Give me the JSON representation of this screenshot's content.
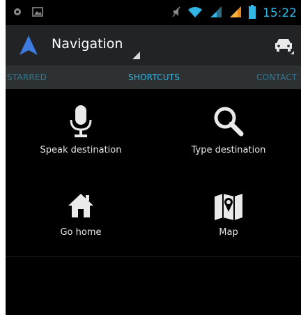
{
  "status_bar": {
    "time": "15:22",
    "icons": [
      "notification-dot-icon",
      "image-icon",
      "mute-icon",
      "wifi-icon",
      "signal-icon",
      "signal-icon",
      "battery-icon"
    ]
  },
  "action_bar": {
    "title": "Navigation",
    "logo_icon": "navigation-arrow-icon",
    "action_icon": "car-icon"
  },
  "tabs": [
    {
      "label": "STARRED"
    },
    {
      "label": "SHORTCUTS",
      "selected": true
    },
    {
      "label": "CONTACT"
    }
  ],
  "shortcuts": [
    {
      "label": "Speak destination",
      "icon": "microphone-icon"
    },
    {
      "label": "Type destination",
      "icon": "search-icon"
    },
    {
      "label": "Go home",
      "icon": "home-icon"
    },
    {
      "label": "Map",
      "icon": "map-icon"
    }
  ],
  "colors": {
    "accent": "#33b5e5",
    "action_bar": "#222324",
    "tab_bar": "#2e3132",
    "logo": "#3d7be0"
  }
}
